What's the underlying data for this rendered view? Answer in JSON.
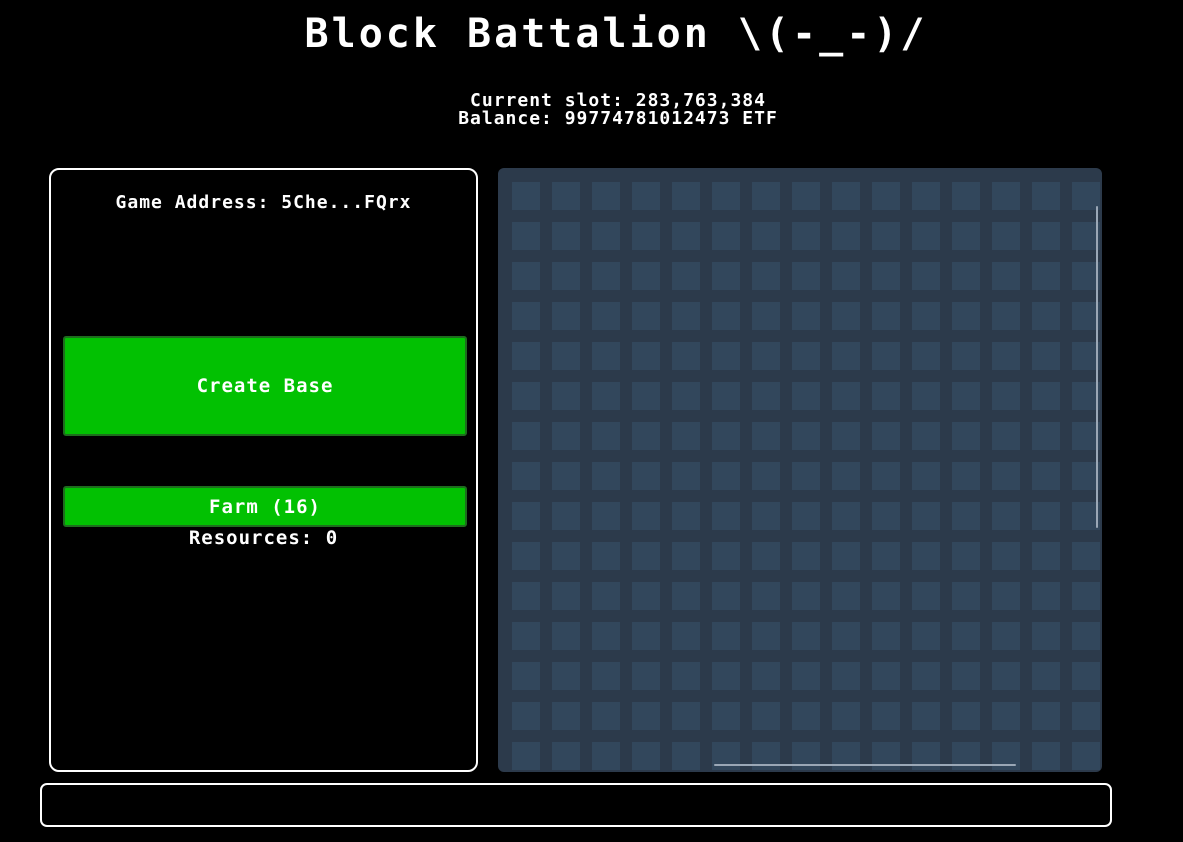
{
  "header": {
    "title": "Block Battalion \\(-_-)/",
    "current_slot": "Current slot: 283,763,384",
    "balance": "Balance: 99774781012473 ETF"
  },
  "sidebar": {
    "game_address": "Game Address: 5Che...FQrx",
    "create_base_label": "Create Base",
    "farm_label": "Farm (16)",
    "resources": "Resources: 0"
  },
  "map": {
    "tile_color": "#32475c",
    "background_color": "#2c3a4b",
    "visible_columns": 15,
    "visible_rows": 15
  },
  "colors": {
    "button_green": "#02c102",
    "background": "#000000",
    "border": "#ffffff"
  },
  "log": {
    "text": ""
  }
}
